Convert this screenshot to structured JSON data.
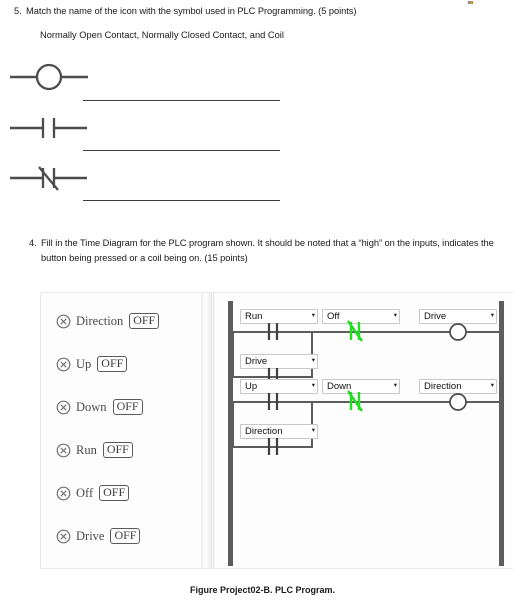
{
  "questions": [
    {
      "number": "5.",
      "text": "Match the name of the icon with the symbol used in PLC Programming. (5 points)",
      "sub": "Normally Open Contact, Normally Closed Contact, and Coil"
    },
    {
      "number": "4.",
      "text": "Fill in the Time Diagram for the PLC program shown.  It should be noted that a “high” on the inputs, indicates the button being pressed or a coil being on.  (15 points)"
    }
  ],
  "symbols": [
    {
      "name": "coil-symbol",
      "answer_line": ""
    },
    {
      "name": "normally-open-contact-symbol",
      "answer_line": ""
    },
    {
      "name": "normally-closed-contact-symbol",
      "answer_line": ""
    }
  ],
  "plc_app": {
    "io_panel": {
      "items": [
        {
          "icon": "x-circle-icon",
          "label": "Direction",
          "state": "OFF"
        },
        {
          "icon": "x-circle-icon",
          "label": "Up",
          "state": "OFF"
        },
        {
          "icon": "x-circle-icon",
          "label": "Down",
          "state": "OFF"
        },
        {
          "icon": "x-circle-icon",
          "label": "Run",
          "state": "OFF"
        },
        {
          "icon": "x-circle-icon",
          "label": "Off",
          "state": "OFF"
        },
        {
          "icon": "x-circle-icon",
          "label": "Drive",
          "state": "OFF"
        }
      ]
    },
    "ladder": {
      "rungs": [
        {
          "name": "rung-drive",
          "elements": [
            {
              "tag": "Run",
              "type": "contact-no",
              "position": "series"
            },
            {
              "tag": "Drive",
              "type": "contact-no",
              "position": "branch"
            },
            {
              "tag": "Off",
              "type": "contact-nc",
              "position": "series"
            },
            {
              "tag": "Drive",
              "type": "coil",
              "position": "output"
            }
          ]
        },
        {
          "name": "rung-direction",
          "elements": [
            {
              "tag": "Up",
              "type": "contact-no",
              "position": "series"
            },
            {
              "tag": "Direction",
              "type": "contact-no",
              "position": "branch"
            },
            {
              "tag": "Down",
              "type": "contact-nc",
              "position": "series"
            },
            {
              "tag": "Direction",
              "type": "coil",
              "position": "output"
            }
          ]
        }
      ],
      "caret_glyph": "▾"
    }
  },
  "colors": {
    "nc_contact_green": "#22dd22",
    "wire_gray": "#5c5c5c",
    "rail_gray": "#5c5c5c",
    "select_border": "#c8c8c8",
    "io_label_gray": "#4a4a4a"
  },
  "caption": "Figure Project02-B. PLC Program."
}
